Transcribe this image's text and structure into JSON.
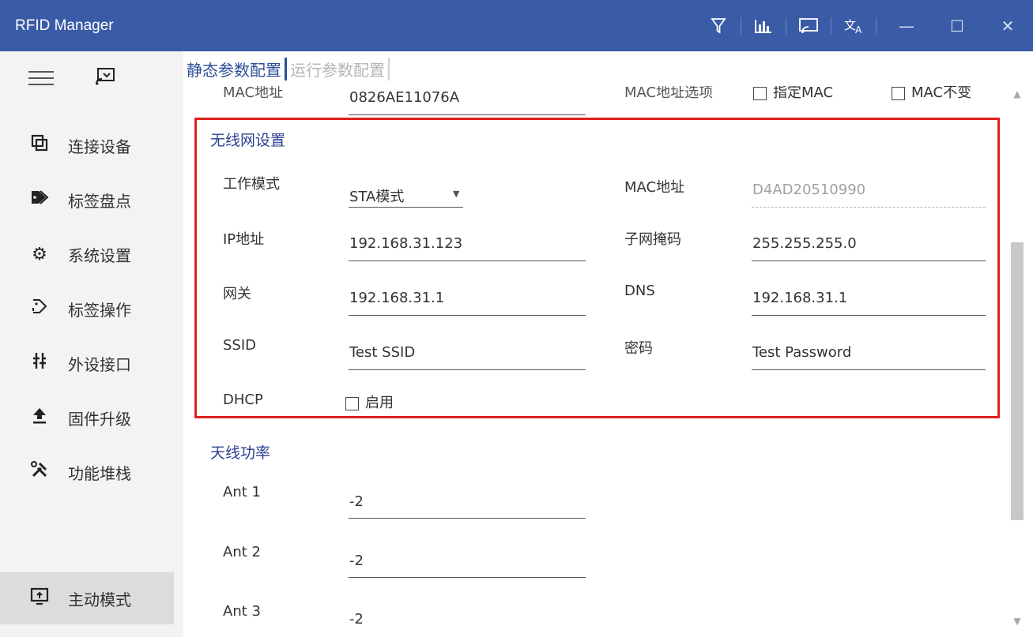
{
  "window": {
    "title": "RFID Manager",
    "toolbar_icons": [
      "filter-icon",
      "chart-icon",
      "screen-icon",
      "translate-icon"
    ],
    "controls": {
      "minimize": "—",
      "maximize": "☐",
      "close": "✕"
    }
  },
  "sidebar": {
    "items": [
      {
        "label": "连接设备",
        "icon": "connect-icon"
      },
      {
        "label": "标签盘点",
        "icon": "tag-icon"
      },
      {
        "label": "系统设置",
        "icon": "gear-icon"
      },
      {
        "label": "标签操作",
        "icon": "tag-operation-icon"
      },
      {
        "label": "外设接口",
        "icon": "interface-icon"
      },
      {
        "label": "固件升级",
        "icon": "upload-icon"
      },
      {
        "label": "功能堆栈",
        "icon": "tools-icon"
      }
    ],
    "bottom_item": {
      "label": "主动模式",
      "icon": "monitor-icon"
    }
  },
  "tabs": {
    "active": "静态参数配置",
    "inactive": "运行参数配置"
  },
  "top_row": {
    "mac_label": "MAC地址",
    "mac_value": "0826AE11076A",
    "mac_option_label": "MAC地址选项",
    "option1": "指定MAC",
    "option2": "MAC不变"
  },
  "wifi": {
    "title": "无线网设置",
    "work_mode_label": "工作模式",
    "work_mode_value": "STA模式",
    "mac_label": "MAC地址",
    "mac_value": "D4AD20510990",
    "ip_label": "IP地址",
    "ip_value": "192.168.31.123",
    "subnet_label": "子网掩码",
    "subnet_value": "255.255.255.0",
    "gateway_label": "网关",
    "gateway_value": "192.168.31.1",
    "dns_label": "DNS",
    "dns_value": "192.168.31.1",
    "ssid_label": "SSID",
    "ssid_value": "Test SSID",
    "password_label": "密码",
    "password_value": "Test Password",
    "dhcp_label": "DHCP",
    "dhcp_checkbox_label": "启用",
    "dhcp_checked": false
  },
  "antenna": {
    "title": "天线功率",
    "ants": [
      {
        "label": "Ant 1",
        "value": "-2"
      },
      {
        "label": "Ant 2",
        "value": "-2"
      },
      {
        "label": "Ant 3",
        "value": "-2"
      }
    ]
  },
  "colors": {
    "titlebar": "#3a5ba6",
    "accent": "#2d4d9a",
    "highlight_box": "#e02020"
  }
}
